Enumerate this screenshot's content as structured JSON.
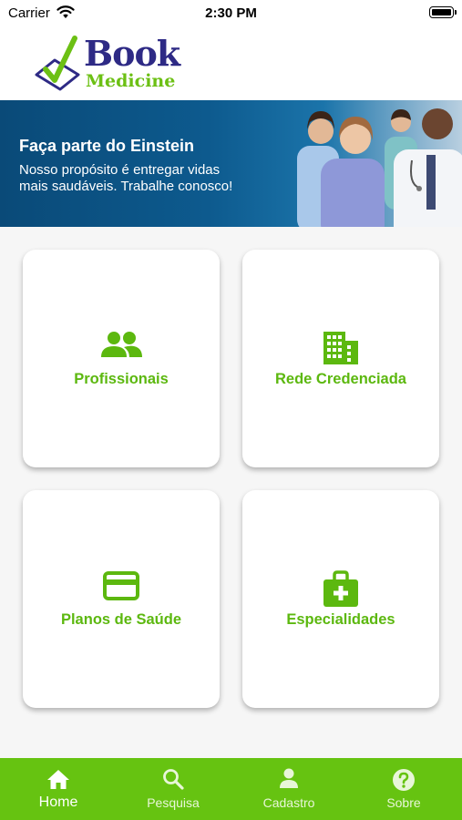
{
  "status_bar": {
    "carrier": "Carrier",
    "time": "2:30 PM"
  },
  "header": {
    "logo_line1": "Book",
    "logo_line2": "Medicine"
  },
  "banner": {
    "title": "Faça parte do Einstein",
    "line1": "Nosso propósito é entregar vidas",
    "line2": "mais saudáveis. Trabalhe conosco!"
  },
  "cards": [
    {
      "label": "Profissionais",
      "icon": "people-icon"
    },
    {
      "label": "Rede Credenciada",
      "icon": "building-icon"
    },
    {
      "label": "Planos de Saúde",
      "icon": "credit-card-icon"
    },
    {
      "label": "Especialidades",
      "icon": "medical-bag-icon"
    }
  ],
  "tabbar": {
    "items": [
      {
        "label": "Home",
        "icon": "home-icon",
        "active": true
      },
      {
        "label": "Pesquisa",
        "icon": "search-icon",
        "active": false
      },
      {
        "label": "Cadastro",
        "icon": "person-icon",
        "active": false
      },
      {
        "label": "Sobre",
        "icon": "help-icon",
        "active": false
      }
    ]
  },
  "colors": {
    "accent_green": "#5cb80f",
    "tabbar_green": "#66c311",
    "logo_navy": "#2e2a85",
    "banner_blue": "#0d5a8e"
  }
}
